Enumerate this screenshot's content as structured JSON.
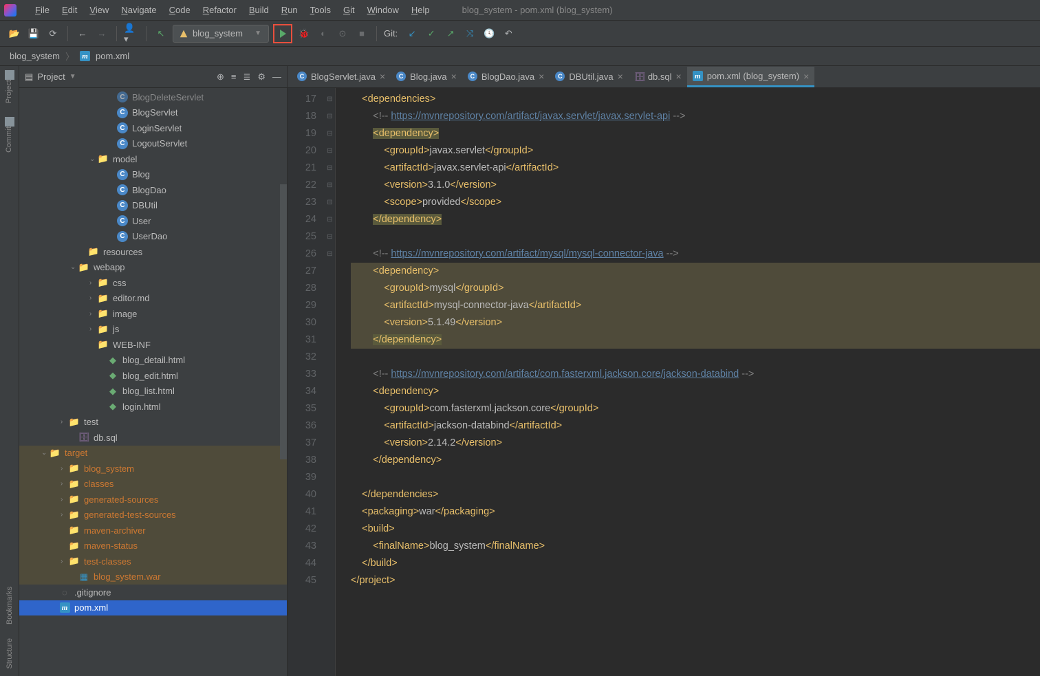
{
  "title": "blog_system - pom.xml (blog_system)",
  "menu": [
    "File",
    "Edit",
    "View",
    "Navigate",
    "Code",
    "Refactor",
    "Build",
    "Run",
    "Tools",
    "Git",
    "Window",
    "Help"
  ],
  "runConfig": "blog_system",
  "gitLabel": "Git:",
  "breadcrumb": {
    "root": "blog_system",
    "file": "pom.xml"
  },
  "sidebar": {
    "title": "Project",
    "tree": [
      {
        "indent": 130,
        "icon": "class",
        "label": "BlogDeleteServlet",
        "dim": true
      },
      {
        "indent": 130,
        "icon": "class",
        "label": "BlogServlet"
      },
      {
        "indent": 130,
        "icon": "class",
        "label": "LoginServlet"
      },
      {
        "indent": 130,
        "icon": "class",
        "label": "LogoutServlet"
      },
      {
        "indent": 102,
        "arrow": "v",
        "icon": "folder",
        "label": "model"
      },
      {
        "indent": 130,
        "icon": "class",
        "label": "Blog"
      },
      {
        "indent": 130,
        "icon": "class",
        "label": "BlogDao"
      },
      {
        "indent": 130,
        "icon": "class",
        "label": "DBUtil"
      },
      {
        "indent": 130,
        "icon": "class",
        "label": "User"
      },
      {
        "indent": 130,
        "icon": "class",
        "label": "UserDao"
      },
      {
        "indent": 88,
        "icon": "folder",
        "label": "resources"
      },
      {
        "indent": 74,
        "arrow": "v",
        "icon": "folder",
        "label": "webapp"
      },
      {
        "indent": 102,
        "arrow": ">",
        "icon": "folder",
        "label": "css"
      },
      {
        "indent": 102,
        "arrow": ">",
        "icon": "folder",
        "label": "editor.md"
      },
      {
        "indent": 102,
        "arrow": ">",
        "icon": "folder",
        "label": "image"
      },
      {
        "indent": 102,
        "arrow": ">",
        "icon": "folder",
        "label": "js"
      },
      {
        "indent": 102,
        "icon": "folder",
        "label": "WEB-INF"
      },
      {
        "indent": 116,
        "icon": "html",
        "label": "blog_detail.html"
      },
      {
        "indent": 116,
        "icon": "html",
        "label": "blog_edit.html"
      },
      {
        "indent": 116,
        "icon": "html",
        "label": "blog_list.html"
      },
      {
        "indent": 116,
        "icon": "html",
        "label": "login.html"
      },
      {
        "indent": 60,
        "arrow": ">",
        "icon": "folder",
        "label": "test"
      },
      {
        "indent": 74,
        "icon": "db",
        "label": "db.sql"
      },
      {
        "indent": 32,
        "arrow": "v",
        "icon": "folder-o",
        "label": "target",
        "hl": true,
        "orange": true
      },
      {
        "indent": 60,
        "arrow": ">",
        "icon": "folder-o",
        "label": "blog_system",
        "hl": true,
        "orange": true
      },
      {
        "indent": 60,
        "arrow": ">",
        "icon": "folder-o",
        "label": "classes",
        "hl": true,
        "orange": true
      },
      {
        "indent": 60,
        "arrow": ">",
        "icon": "folder-o",
        "label": "generated-sources",
        "hl": true,
        "orange": true
      },
      {
        "indent": 60,
        "arrow": ">",
        "icon": "folder-o",
        "label": "generated-test-sources",
        "hl": true,
        "orange": true
      },
      {
        "indent": 60,
        "icon": "folder-o",
        "label": "maven-archiver",
        "hl": true,
        "orange": true
      },
      {
        "indent": 60,
        "icon": "folder-o",
        "label": "maven-status",
        "hl": true,
        "orange": true
      },
      {
        "indent": 60,
        "arrow": ">",
        "icon": "folder-o",
        "label": "test-classes",
        "hl": true,
        "orange": true
      },
      {
        "indent": 74,
        "icon": "war",
        "label": "blog_system.war",
        "hl": true,
        "orange": true
      },
      {
        "indent": 46,
        "icon": "git",
        "label": ".gitignore"
      },
      {
        "indent": 46,
        "icon": "m",
        "label": "pom.xml",
        "sel": true
      }
    ]
  },
  "tabs": [
    {
      "icon": "c",
      "label": "BlogServlet.java"
    },
    {
      "icon": "c",
      "label": "Blog.java"
    },
    {
      "icon": "c",
      "label": "BlogDao.java"
    },
    {
      "icon": "c",
      "label": "DBUtil.java"
    },
    {
      "icon": "db",
      "label": "db.sql"
    },
    {
      "icon": "m",
      "label": "pom.xml (blog_system)",
      "active": true
    }
  ],
  "code": {
    "start": 17,
    "lines": [
      {
        "n": 17,
        "html": "    <span class='tag'>&lt;dependencies&gt;</span>",
        "fold": "-"
      },
      {
        "n": 18,
        "html": "        <span class='comment'>&lt;!-- <span class='link'>https://mvnrepository.com/artifact/javax.servlet/javax.servlet-api</span> --&gt;</span>"
      },
      {
        "n": 19,
        "html": "        <span class='hl-tag'><span class='tag'>&lt;dependency&gt;</span></span>",
        "fold": "-"
      },
      {
        "n": 20,
        "html": "            <span class='tag'>&lt;groupId&gt;</span>javax.servlet<span class='tag'>&lt;/groupId&gt;</span>"
      },
      {
        "n": 21,
        "html": "            <span class='tag'>&lt;artifactId&gt;</span>javax.servlet-api<span class='tag'>&lt;/artifactId&gt;</span>"
      },
      {
        "n": 22,
        "html": "            <span class='tag'>&lt;version&gt;</span>3.1.0<span class='tag'>&lt;/version&gt;</span>"
      },
      {
        "n": 23,
        "html": "            <span class='tag'>&lt;scope&gt;</span>provided<span class='tag'>&lt;/scope&gt;</span>"
      },
      {
        "n": 24,
        "html": "        <span class='hl-tag'><span class='tag'>&lt;/dependency&gt;</span></span>",
        "fold": "-"
      },
      {
        "n": 25,
        "html": ""
      },
      {
        "n": 26,
        "html": "        <span class='comment'>&lt;!-- <span class='link'>https://mvnrepository.com/artifact/mysql/mysql-connector-java</span> --&gt;</span>"
      },
      {
        "n": 27,
        "html": "        <span class='tag'>&lt;dependency&gt;</span>",
        "fold": "-",
        "hlfull": true
      },
      {
        "n": 28,
        "html": "            <span class='tag'>&lt;groupId&gt;</span>mysql<span class='tag'>&lt;/groupId&gt;</span>",
        "hlfull": true
      },
      {
        "n": 29,
        "html": "            <span class='tag'>&lt;artifactId&gt;</span>mysql-connector-java<span class='tag'>&lt;/artifactId&gt;</span>",
        "hlfull": true
      },
      {
        "n": 30,
        "html": "            <span class='tag'>&lt;version&gt;</span>5.1.49<span class='tag'>&lt;/version&gt;</span>",
        "hlfull": true
      },
      {
        "n": 31,
        "html": "        <span class='hl-tag'><span class='tag'>&lt;/dependency&gt;</span></span>",
        "fold": "-",
        "hlfull": true
      },
      {
        "n": 32,
        "html": ""
      },
      {
        "n": 33,
        "html": "        <span class='comment'>&lt;!-- <span class='link'>https://mvnrepository.com/artifact/com.fasterxml.jackson.core/jackson-databind</span> --&gt;</span>"
      },
      {
        "n": 34,
        "html": "        <span class='tag'>&lt;dependency&gt;</span>",
        "fold": "-"
      },
      {
        "n": 35,
        "html": "            <span class='tag'>&lt;groupId&gt;</span>com.fasterxml.jackson.core<span class='tag'>&lt;/groupId&gt;</span>"
      },
      {
        "n": 36,
        "html": "            <span class='tag'>&lt;artifactId&gt;</span>jackson-databind<span class='tag'>&lt;/artifactId&gt;</span>"
      },
      {
        "n": 37,
        "html": "            <span class='tag'>&lt;version&gt;</span>2.14.2<span class='tag'>&lt;/version&gt;</span>"
      },
      {
        "n": 38,
        "html": "        <span class='tag'>&lt;/dependency&gt;</span>",
        "fold": "-"
      },
      {
        "n": 39,
        "html": ""
      },
      {
        "n": 40,
        "html": "    <span class='tag'>&lt;/dependencies&gt;</span>",
        "fold": "-"
      },
      {
        "n": 41,
        "html": "    <span class='tag'>&lt;packaging&gt;</span>war<span class='tag'>&lt;/packaging&gt;</span>"
      },
      {
        "n": 42,
        "html": "    <span class='tag'>&lt;build&gt;</span>",
        "fold": "-"
      },
      {
        "n": 43,
        "html": "        <span class='tag'>&lt;finalName&gt;</span>blog_system<span class='tag'>&lt;/finalName&gt;</span>"
      },
      {
        "n": 44,
        "html": "    <span class='tag'>&lt;/build&gt;</span>",
        "fold": "-"
      },
      {
        "n": 45,
        "html": "<span class='tag'>&lt;/project&gt;</span>"
      }
    ]
  },
  "leftRail": {
    "top": [
      "Project",
      "Commit"
    ],
    "bottom": [
      "Bookmarks",
      "Structure"
    ]
  }
}
